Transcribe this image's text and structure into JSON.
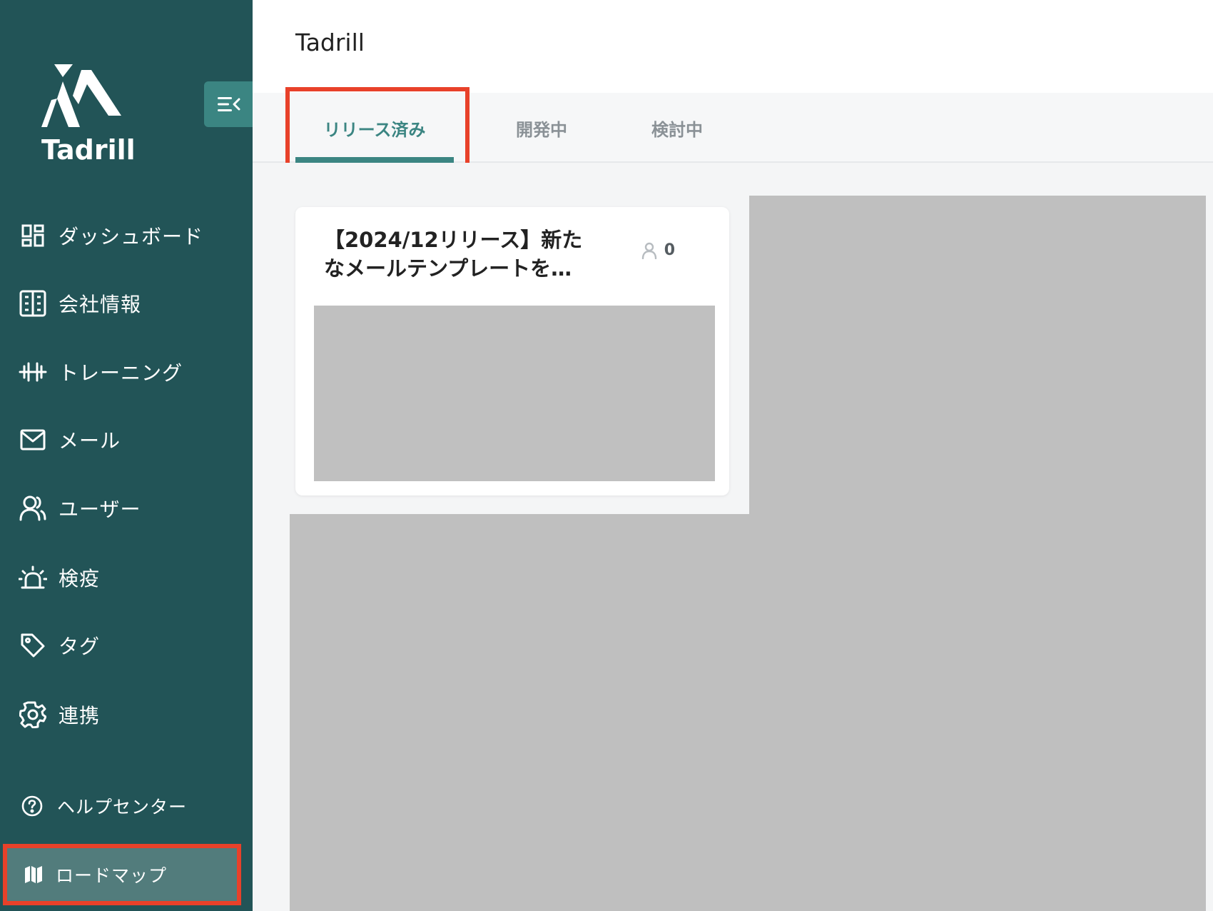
{
  "app": {
    "title": "Tadrill",
    "logo_text": "Tadrill"
  },
  "sidebar": {
    "items": [
      {
        "label": "ダッシュボード",
        "icon": "dashboard-icon"
      },
      {
        "label": "会社情報",
        "icon": "building-icon"
      },
      {
        "label": "トレーニング",
        "icon": "dumbbell-icon"
      },
      {
        "label": "メール",
        "icon": "mail-icon"
      },
      {
        "label": "ユーザー",
        "icon": "users-icon"
      },
      {
        "label": "検疫",
        "icon": "alarm-icon"
      },
      {
        "label": "タグ",
        "icon": "tag-icon"
      },
      {
        "label": "連携",
        "icon": "gear-icon"
      }
    ],
    "bottom_items": [
      {
        "label": "ヘルプセンター",
        "icon": "help-circle-icon"
      },
      {
        "label": "ロードマップ",
        "icon": "map-icon",
        "active": true
      }
    ]
  },
  "tabs": [
    {
      "label": "リリース済み",
      "active": true
    },
    {
      "label": "開発中",
      "active": false
    },
    {
      "label": "検討中",
      "active": false
    }
  ],
  "cards": [
    {
      "title": "【2024/12リリース】新たなメールテンプレートを…",
      "count": "0"
    }
  ],
  "colors": {
    "sidebar_bg": "#225457",
    "accent": "#3b8582",
    "highlight": "#e8412a"
  }
}
